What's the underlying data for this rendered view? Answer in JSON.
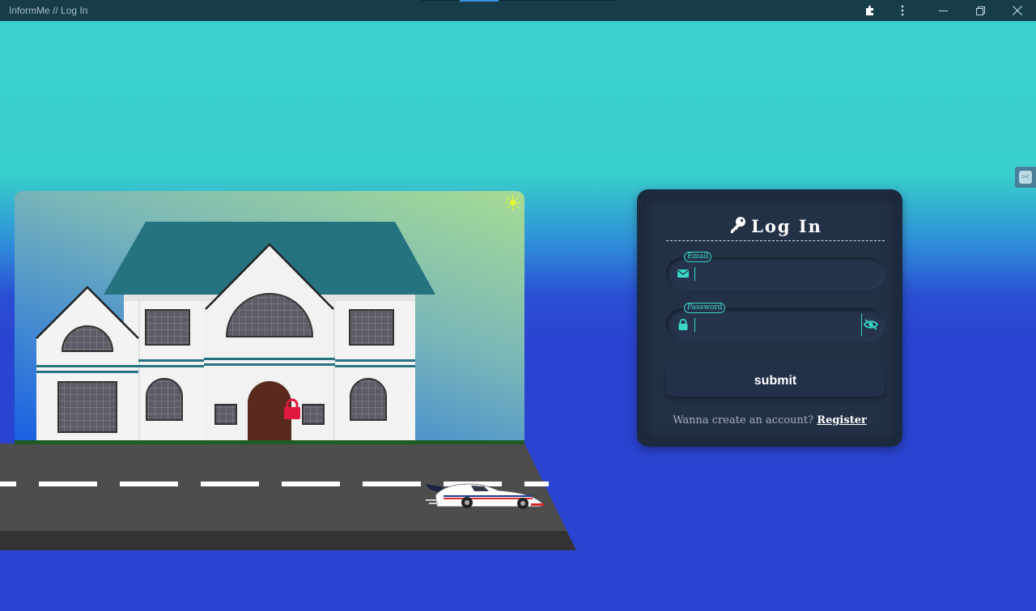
{
  "window": {
    "title": "InformMe // Log In",
    "buttons": [
      "extensions-icon",
      "more-icon",
      "minimize-icon",
      "restore-icon",
      "close-icon"
    ]
  },
  "colors": {
    "accent": "#3ad7c6",
    "card_bg": "#1c2a3f",
    "lock": "#e0173e",
    "roof": "#267380"
  },
  "login": {
    "title": "Log In",
    "email": {
      "label": "Email",
      "value": ""
    },
    "password": {
      "label": "Password",
      "value": ""
    },
    "submit_label": "submit",
    "register_prompt": "Wanna create an account?",
    "register_link": "Register"
  }
}
